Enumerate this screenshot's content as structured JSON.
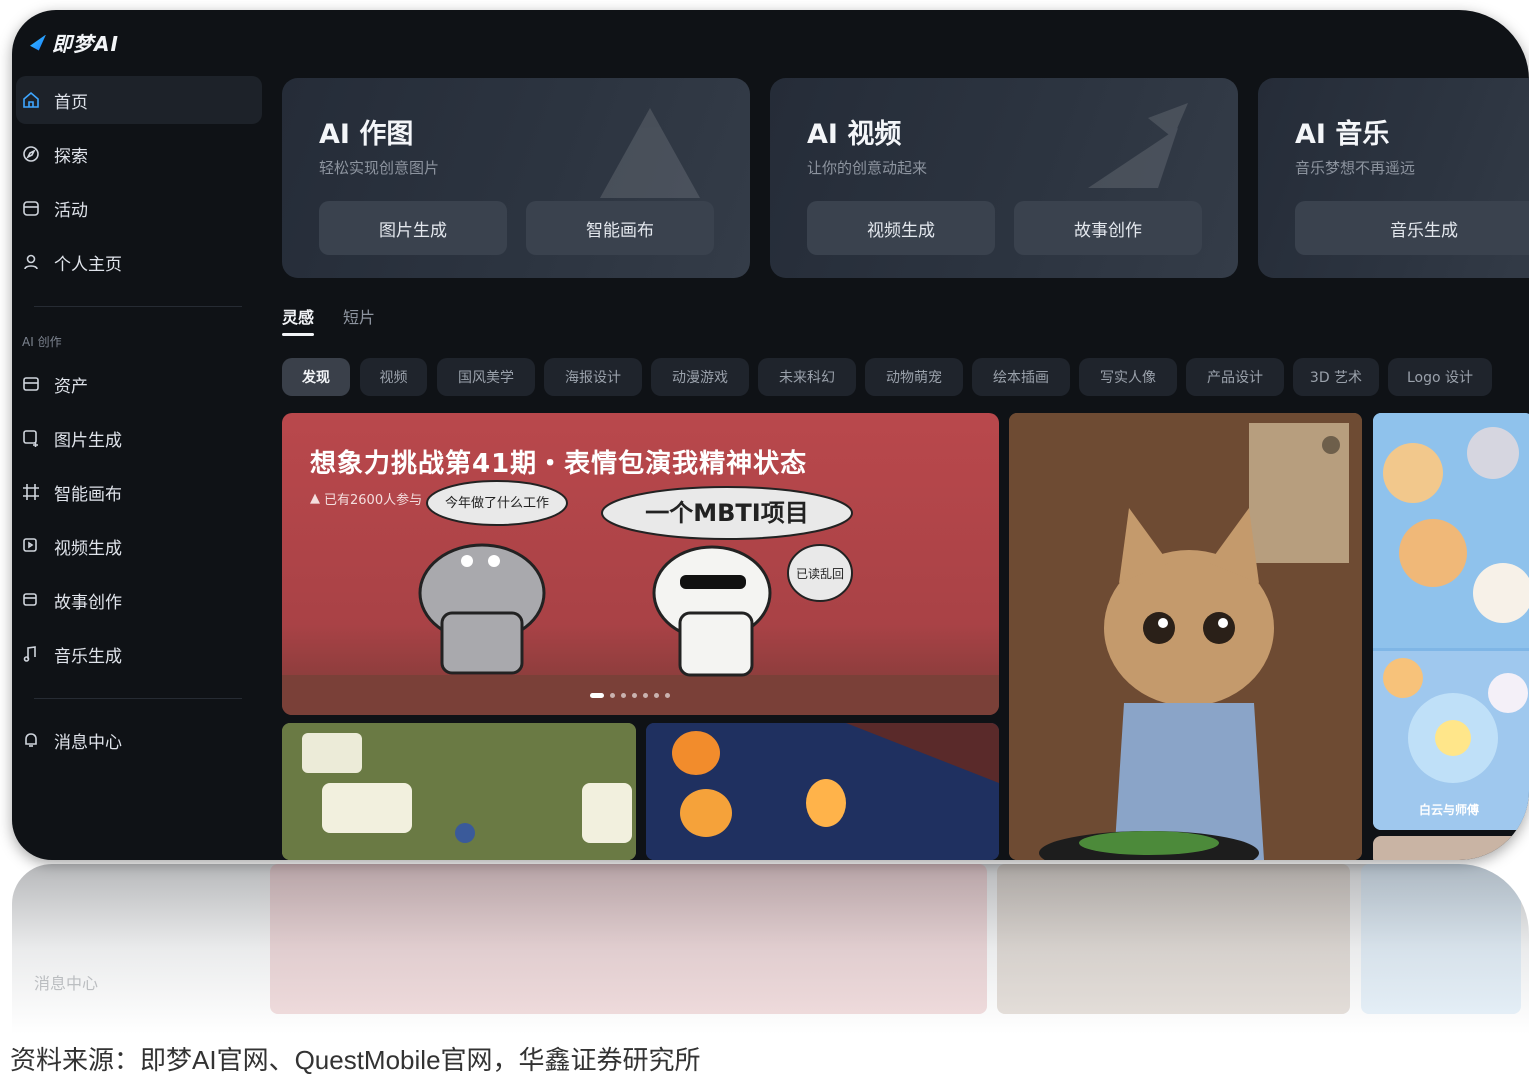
{
  "app": {
    "logo_text": "即梦AI",
    "brand_color": "#1a7bff",
    "bg_color": "#0f1216"
  },
  "sidebar": {
    "items": [
      {
        "label": "首页",
        "icon": "home-icon",
        "active": true
      },
      {
        "label": "探索",
        "icon": "compass-icon"
      },
      {
        "label": "活动",
        "icon": "calendar-icon"
      },
      {
        "label": "个人主页",
        "icon": "user-icon"
      }
    ],
    "section_label": "AI 创作",
    "create_items": [
      {
        "label": "资产",
        "icon": "folder-icon"
      },
      {
        "label": "图片生成",
        "icon": "image-gen-icon"
      },
      {
        "label": "智能画布",
        "icon": "canvas-icon"
      },
      {
        "label": "视频生成",
        "icon": "video-gen-icon"
      },
      {
        "label": "故事创作",
        "icon": "story-icon"
      },
      {
        "label": "音乐生成",
        "icon": "music-icon"
      }
    ],
    "bottom_items": [
      {
        "label": "消息中心",
        "icon": "bell-icon"
      }
    ]
  },
  "feature_cards": [
    {
      "title": "AI 作图",
      "subtitle": "轻松实现创意图片",
      "buttons": [
        "图片生成",
        "智能画布"
      ]
    },
    {
      "title": "AI 视频",
      "subtitle": "让你的创意动起来",
      "buttons": [
        "视频生成",
        "故事创作"
      ]
    },
    {
      "title": "AI 音乐",
      "subtitle": "音乐梦想不再遥远",
      "buttons": [
        "音乐生成"
      ]
    }
  ],
  "tabs": [
    {
      "label": "灵感",
      "active": true
    },
    {
      "label": "短片",
      "active": false
    }
  ],
  "categories": [
    "发现",
    "视频",
    "国风美学",
    "海报设计",
    "动漫游戏",
    "未来科幻",
    "动物萌宠",
    "绘本插画",
    "写实人像",
    "产品设计",
    "3D 艺术",
    "Logo 设计"
  ],
  "banner": {
    "title": "想象力挑战第41期・表情包演我精神状态",
    "participants": "已有2600人参与",
    "bubble_left": "今年做了什么工作",
    "bubble_center": "一个MBTI项目",
    "bubble_right": "已读乱回",
    "bg_color": "#b9484c"
  },
  "gallery": {
    "grid_caption": "白云与师傅"
  },
  "reflection_label": "消息中心",
  "source_caption": "资料来源：即梦AI官网、QuestMobile官网，华鑫证券研究所"
}
